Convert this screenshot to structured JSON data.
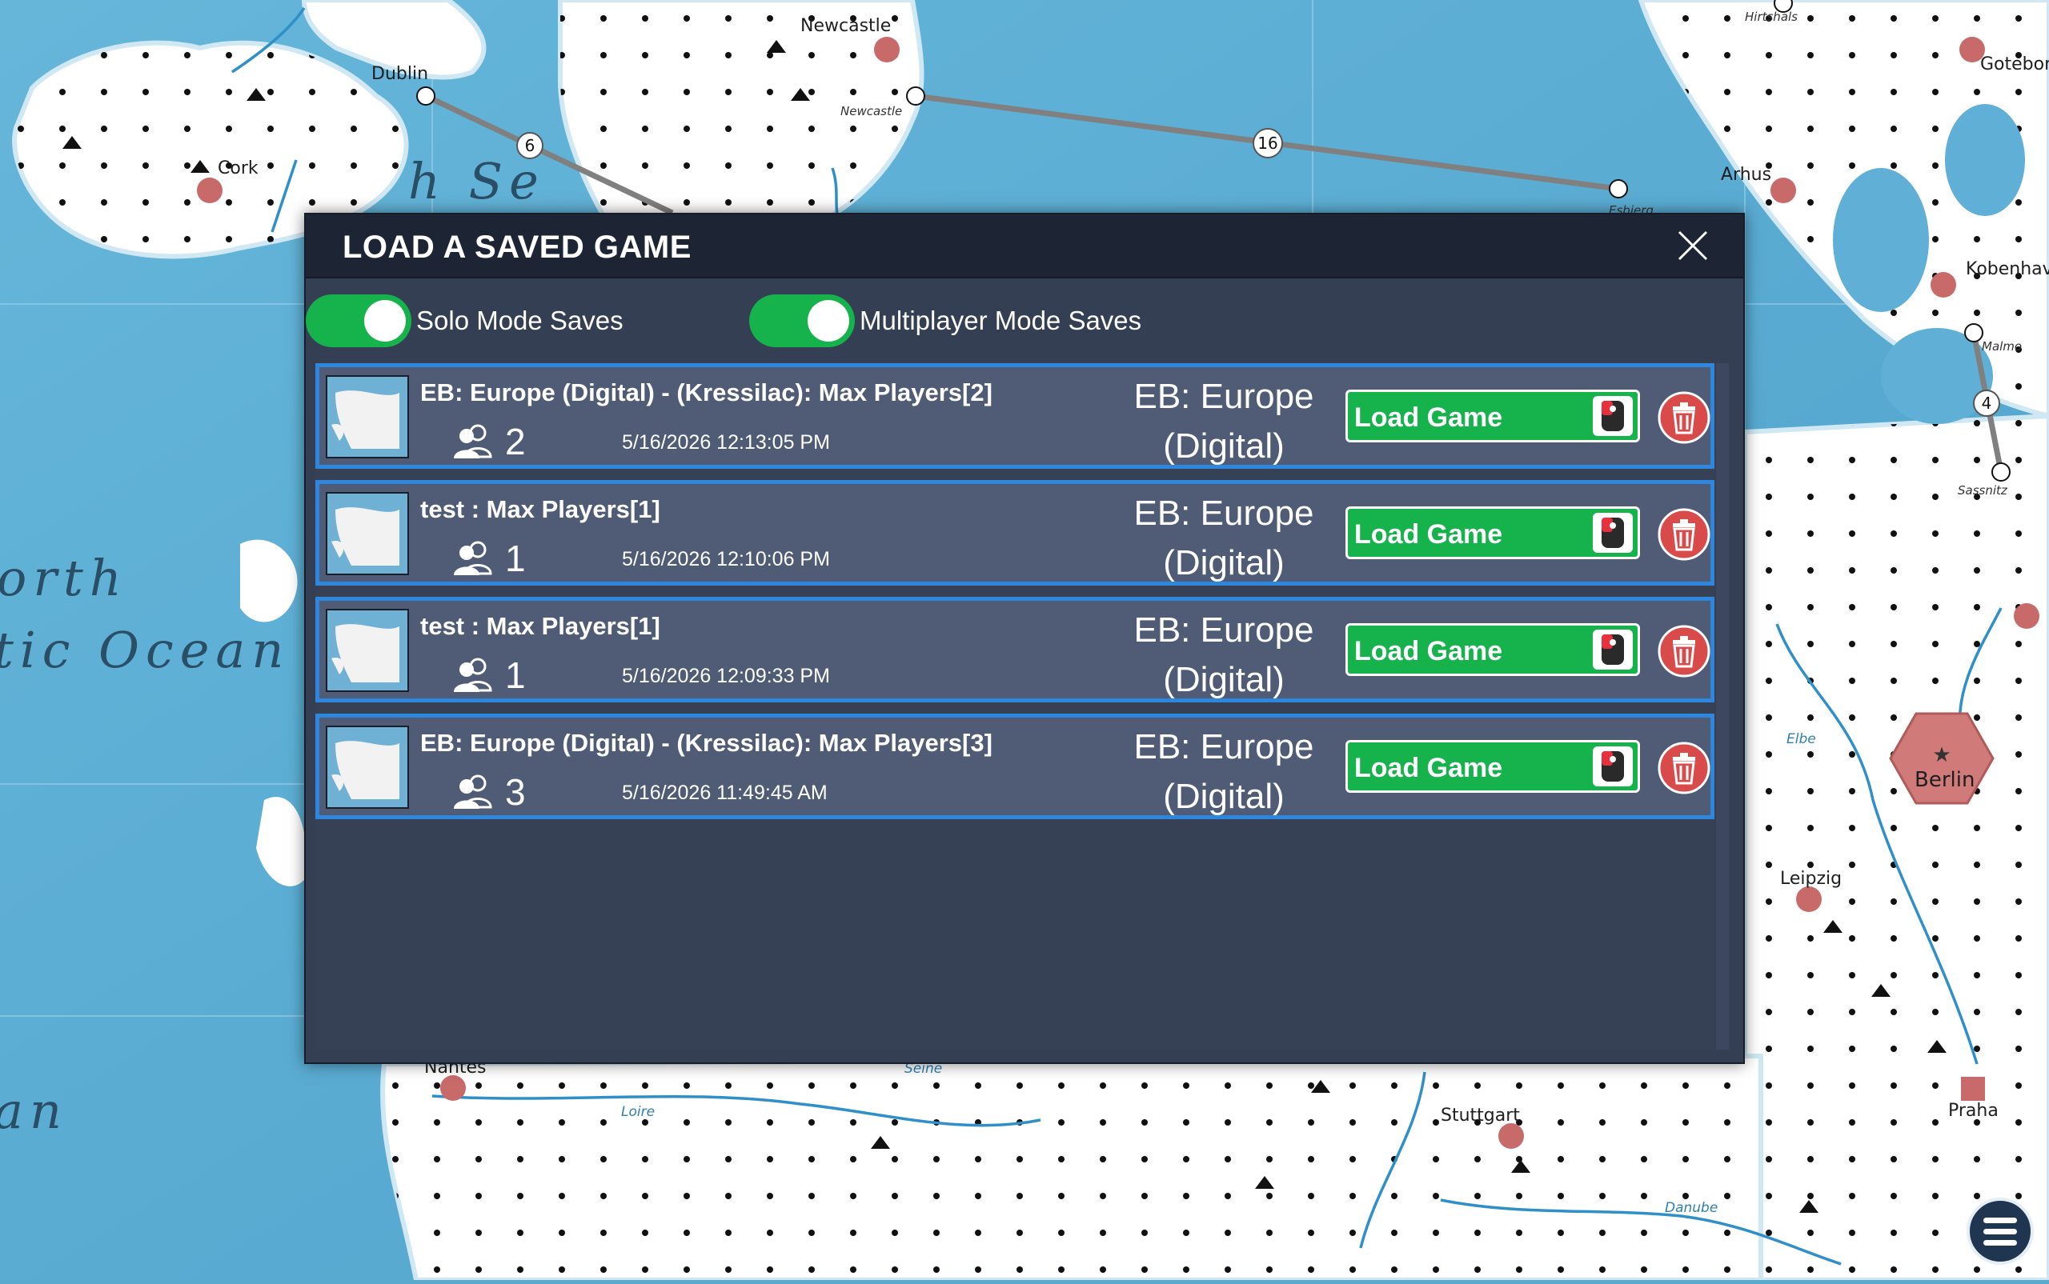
{
  "map": {
    "cities": [
      {
        "name": "Dublin"
      },
      {
        "name": "Newcastle"
      },
      {
        "name": "Cork"
      },
      {
        "name": "Arhus"
      },
      {
        "name": "Kobenhav"
      },
      {
        "name": "Goteborg"
      },
      {
        "name": "Berlin"
      },
      {
        "name": "Leipzig"
      },
      {
        "name": "Praha"
      },
      {
        "name": "Stuttgart"
      },
      {
        "name": "Nantes"
      }
    ],
    "ports": [
      "Newcastle",
      "Esbjerg",
      "Malmo",
      "Sassnitz",
      "Hirtshals"
    ],
    "rivers": [
      "Loire",
      "Elbe",
      "Danube",
      "Seine"
    ],
    "route_labels": [
      "6",
      "16",
      "4"
    ],
    "sea_labels": [
      "orth",
      "tic Ocean",
      "an",
      "h Se"
    ]
  },
  "dialog": {
    "title": "LOAD A SAVED GAME",
    "toggles": [
      {
        "label": "Solo Mode Saves",
        "on": true
      },
      {
        "label": "Multiplayer Mode Saves",
        "on": true
      }
    ],
    "saves": [
      {
        "name": "EB: Europe (Digital) - (Kressilac): Max Players[2]",
        "players": "2",
        "date": "5/16/2026 12:13:05 PM",
        "module_line1": "EB: Europe",
        "module_line2": "(Digital)",
        "load_label": "Load Game"
      },
      {
        "name": "test : Max Players[1]",
        "players": "1",
        "date": "5/16/2026 12:10:06 PM",
        "module_line1": "EB: Europe",
        "module_line2": "(Digital)",
        "load_label": "Load Game"
      },
      {
        "name": "test : Max Players[1]",
        "players": "1",
        "date": "5/16/2026 12:09:33 PM",
        "module_line1": "EB: Europe",
        "module_line2": "(Digital)",
        "load_label": "Load Game"
      },
      {
        "name": "EB: Europe (Digital) - (Kressilac): Max Players[3]",
        "players": "3",
        "date": "5/16/2026 11:49:45 AM",
        "module_line1": "EB: Europe",
        "module_line2": "(Digital)",
        "load_label": "Load Game"
      }
    ]
  },
  "icons": {
    "close": "close-icon",
    "players": "players-icon",
    "mouse": "mouse-icon",
    "delete": "trash-icon",
    "menu": "hamburger-menu-icon"
  },
  "colors": {
    "accent_green": "#16b24b",
    "row_border_blue": "#2f86dd",
    "delete_red": "#d94a4a",
    "dialog_bg": "#353f54",
    "header_bg": "#1d2535"
  }
}
